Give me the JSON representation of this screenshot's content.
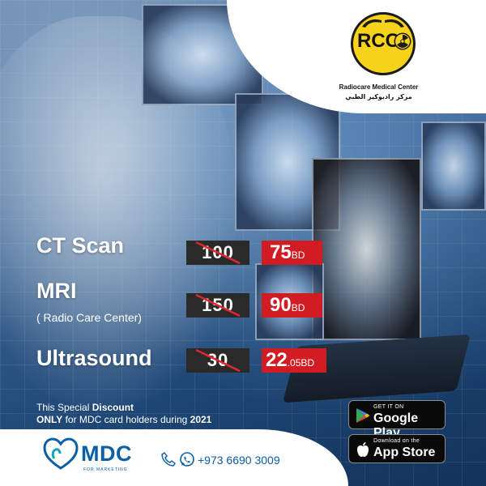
{
  "brand": {
    "logo_initials": "RCC",
    "center_name_en": "Radiocare Medical Center",
    "center_name_ar": "مركز راديوكير الطبي",
    "logo_colors": {
      "yellow": "#f7d21a",
      "dark": "#1b1b1b"
    }
  },
  "offers": [
    {
      "service": "CT Scan",
      "subtitle": "",
      "old_price": "100",
      "new_price_main": "75",
      "new_price_fraction": "",
      "currency": "BD"
    },
    {
      "service": "MRI",
      "subtitle": "( Radio Care Center)",
      "old_price": "150",
      "new_price_main": "90",
      "new_price_fraction": "",
      "currency": "BD"
    },
    {
      "service": "Ultrasound",
      "subtitle": "",
      "old_price": "30",
      "new_price_main": "22",
      "new_price_fraction": ".05",
      "currency": "BD"
    }
  ],
  "disclaimer": {
    "line1_prefix": "This Special ",
    "line1_bold": "Discount",
    "line2_bold": "ONLY",
    "line2_mid": " for MDC card holders during ",
    "line2_year": "2021"
  },
  "stores": {
    "google_small": "GET IT ON",
    "google_big": "Google Play",
    "apple_small": "Download on the",
    "apple_big": "App Store"
  },
  "footer": {
    "mdc_name": "MDC",
    "mdc_tagline": "FOR MARKETING",
    "phone": "+973 6690 3009"
  },
  "colors": {
    "old_price_bg": "#2a2a2a",
    "new_price_bg": "#d11c24",
    "brand_blue": "#0b5fa6"
  },
  "icons": [
    "radiation-icon",
    "hands-icon",
    "strike-line",
    "google-play-icon",
    "apple-icon",
    "heart-icon",
    "phone-icon",
    "whatsapp-icon"
  ]
}
